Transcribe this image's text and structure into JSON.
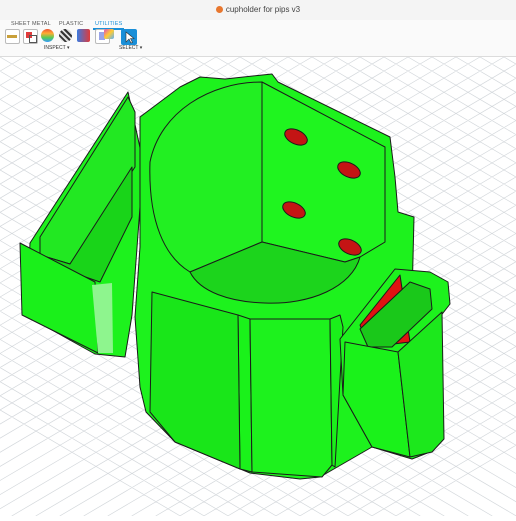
{
  "window": {
    "title": "cupholder for pips v3"
  },
  "ribbon": {
    "tabs": [
      {
        "label": "SHEET METAL",
        "active": false
      },
      {
        "label": "PLASTIC",
        "active": false
      },
      {
        "label": "UTILITIES",
        "active": true
      }
    ],
    "groups": {
      "inspect_label": "INSPECT ▾",
      "select_label": "SELECT ▾"
    },
    "tools": [
      {
        "name": "measure-tool-icon"
      },
      {
        "name": "interference-tool-icon"
      },
      {
        "name": "curvature-tool-icon"
      },
      {
        "name": "zebra-analysis-icon"
      },
      {
        "name": "draft-analysis-icon"
      },
      {
        "name": "section-analysis-icon"
      },
      {
        "name": "component-color-icon"
      },
      {
        "name": "select-tool-icon"
      }
    ]
  },
  "model": {
    "body_color": "#1df21d",
    "highlight_color": "#e01212",
    "edge_color": "#1a1a1a",
    "grid_color": "#d4d8dc"
  }
}
